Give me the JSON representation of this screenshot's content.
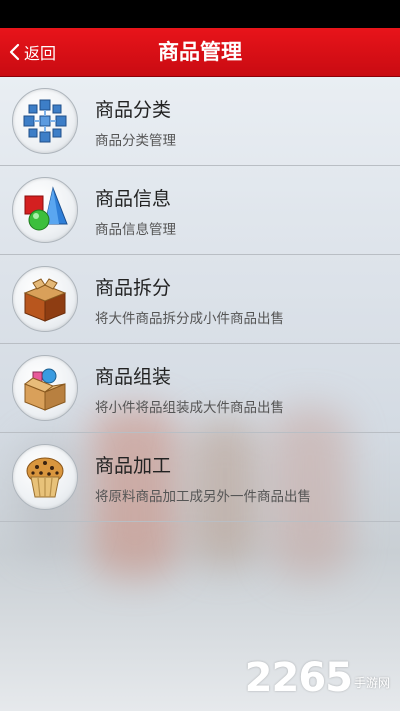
{
  "header": {
    "back_label": "返回",
    "title": "商品管理"
  },
  "menu": {
    "items": [
      {
        "title": "商品分类",
        "subtitle": "商品分类管理",
        "icon": "blue-cubes-icon"
      },
      {
        "title": "商品信息",
        "subtitle": "商品信息管理",
        "icon": "shapes-icon"
      },
      {
        "title": "商品拆分",
        "subtitle": "将大件商品拆分成小件商品出售",
        "icon": "open-box-icon"
      },
      {
        "title": "商品组装",
        "subtitle": "将小件将品组装成大件商品出售",
        "icon": "box-with-items-icon"
      },
      {
        "title": "商品加工",
        "subtitle": "将原料商品加工成另外一件商品出售",
        "icon": "muffin-icon"
      }
    ]
  },
  "watermark": {
    "number": "2265",
    "text": "手游网"
  },
  "colors": {
    "header_red": "#d6101a",
    "title_text": "#222222",
    "subtitle_text": "#555555"
  }
}
